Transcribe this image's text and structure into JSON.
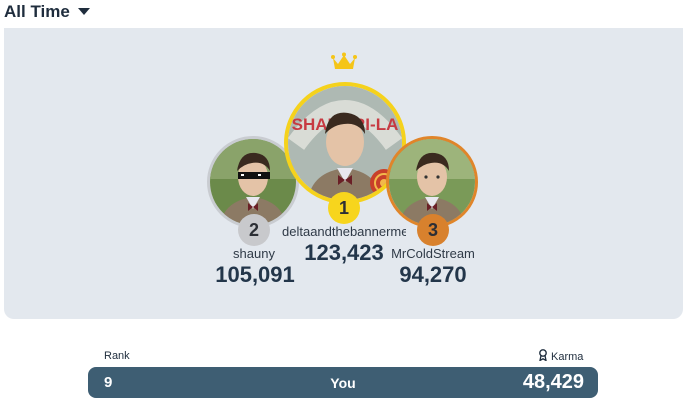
{
  "header": {
    "period_label": "All Time",
    "caret_icon": "caret-down-icon"
  },
  "podium": {
    "first": {
      "rank": "1",
      "username": "deltaandthebannermen",
      "karma": "123,423",
      "badge_color": "#f7d51d",
      "ring_color": "#f5d21c",
      "avatar_text": "SHANGRI-LA"
    },
    "second": {
      "rank": "2",
      "username": "shauny",
      "karma": "105,091",
      "badge_color": "#c8c9cc",
      "ring_color": "#c9ccd1"
    },
    "third": {
      "rank": "3",
      "username": "MrColdStream",
      "karma": "94,270",
      "badge_color": "#d8812d",
      "ring_color": "#e0852a"
    },
    "crown_icon": "crown-icon"
  },
  "table": {
    "rank_header": "Rank",
    "karma_header": "Karma",
    "karma_icon": "award-icon",
    "you_row": {
      "rank": "9",
      "name": "You",
      "karma": "48,429",
      "bg_color": "#3e5e73"
    }
  }
}
